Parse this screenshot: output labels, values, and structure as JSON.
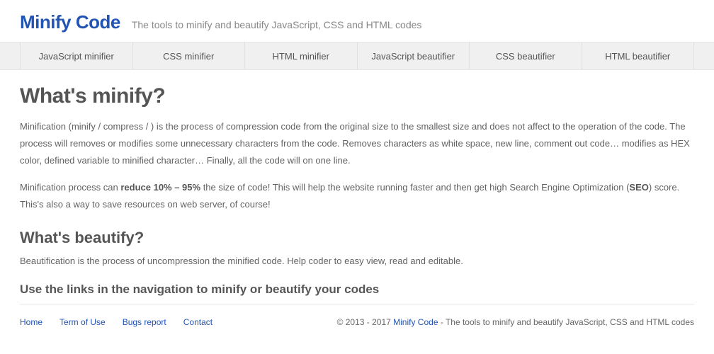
{
  "header": {
    "site_title": "Minify Code",
    "tagline": "The tools to minify and beautify JavaScript, CSS and HTML codes"
  },
  "nav": [
    "JavaScript minifier",
    "CSS minifier",
    "HTML minifier",
    "JavaScript beautifier",
    "CSS beautifier",
    "HTML beautifier"
  ],
  "main": {
    "h1": "What's minify?",
    "p1a": "Minification (minify / compress / ) is the process of compression code from the original size to the smallest size and does not affect to the operation of the code. The process will removes or modifies some unnecessary characters from the code. Removes characters as white space, new line, comment out code… modifies as HEX color, defined variable to minified character… Finally, all the code will on one line.",
    "p2a": "Minification process can ",
    "p2b": "reduce 10% – 95%",
    "p2c": " the size of code! This will help the website running faster and then get high Search Engine Optimization (",
    "p2d": "SEO",
    "p2e": ") score. This's also a way to save resources on web server, of course!",
    "h2": "What's beautify?",
    "p3": "Beautification is the process of uncompression the minified code. Help coder to easy view, read and editable.",
    "h3": "Use the links in the navigation to minify or beautify your codes"
  },
  "footer": {
    "links": [
      "Home",
      "Term of Use",
      "Bugs report",
      "Contact"
    ],
    "copy_left": "© 2013 - 2017 ",
    "copy_link": "Minify Code",
    "copy_right": " - The tools to minify and beautify JavaScript, CSS and HTML codes"
  }
}
